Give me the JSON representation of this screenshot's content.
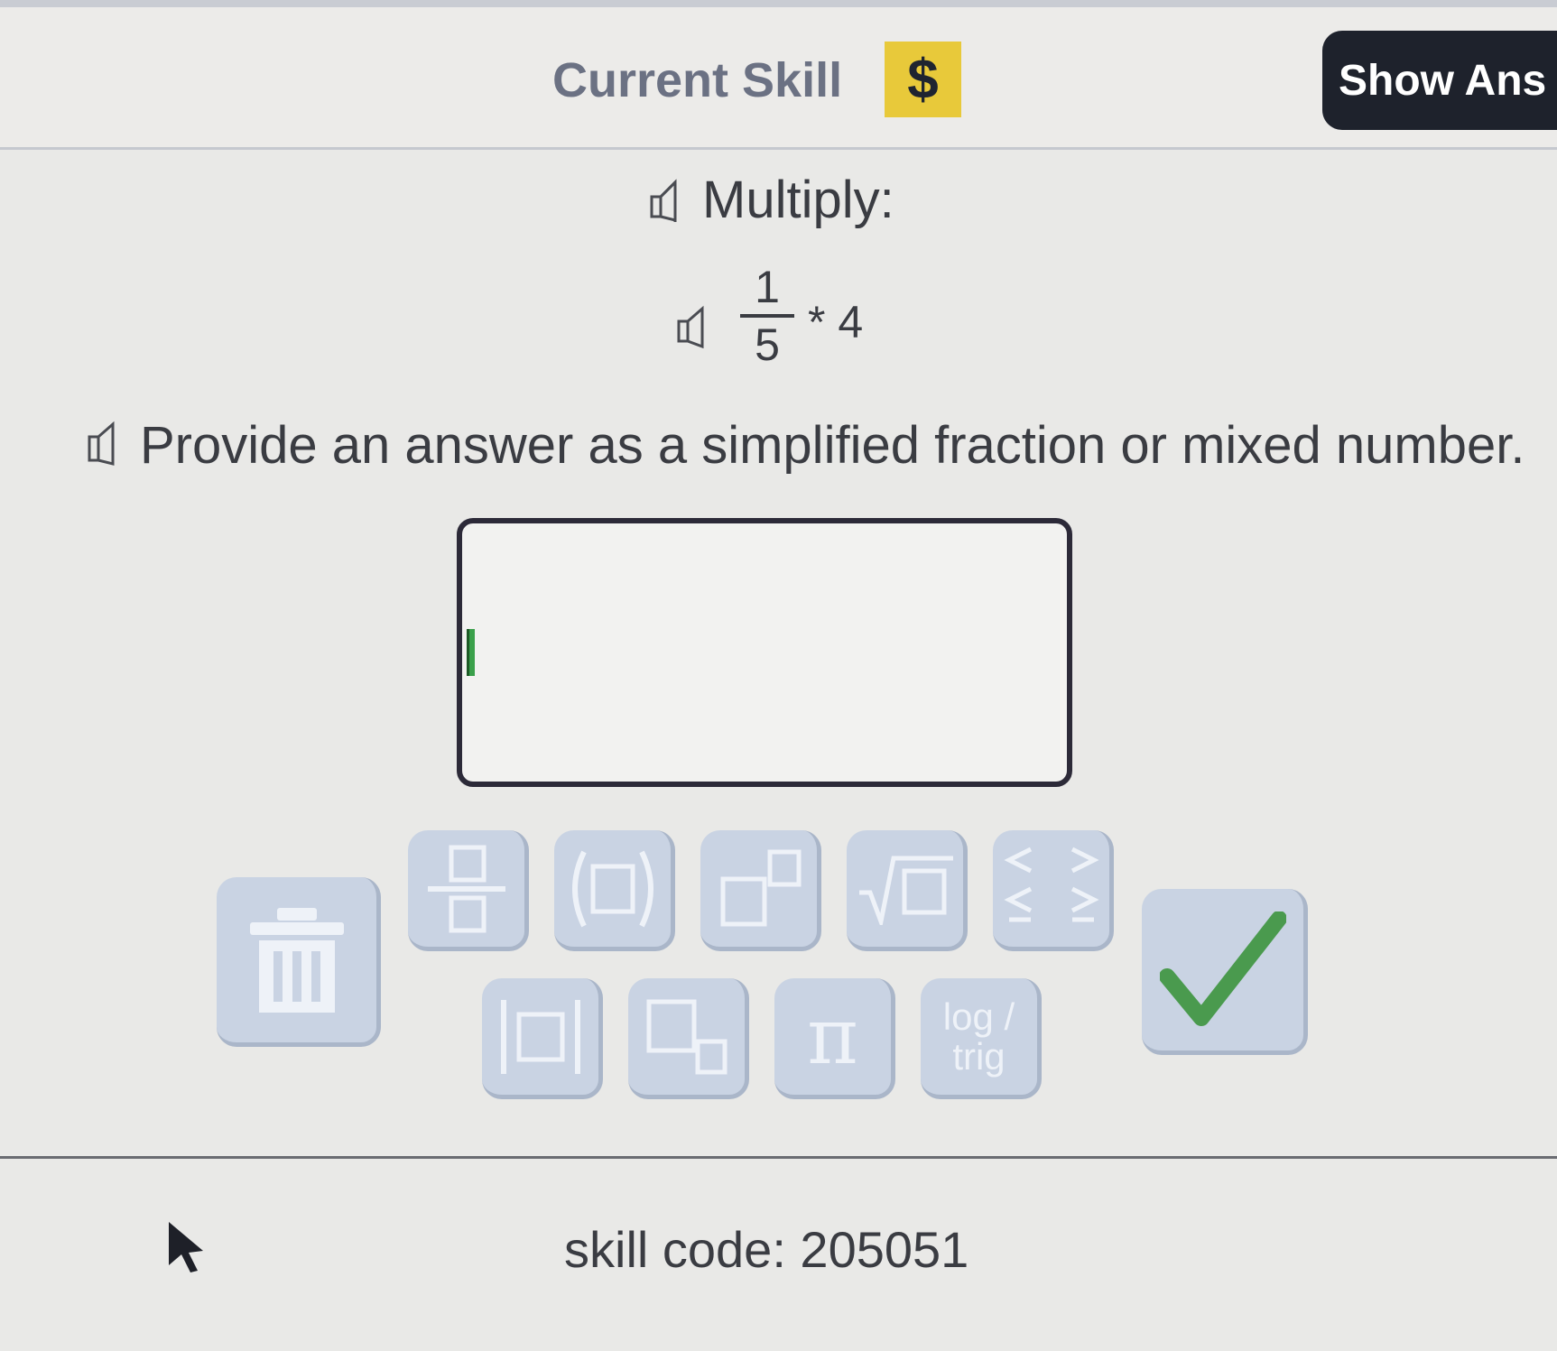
{
  "header": {
    "title": "Current Skill",
    "badge": "$",
    "show_answer_label": "Show Ans"
  },
  "question": {
    "instruction": "Multiply:",
    "expression": {
      "numerator": "1",
      "denominator": "5",
      "operator": "*",
      "operand": "4"
    },
    "answer_prompt": "Provide an answer as a simplified fraction or mixed number."
  },
  "answer": {
    "value": ""
  },
  "keypad": {
    "buttons": [
      {
        "name": "delete",
        "icon": "trash-icon"
      },
      {
        "name": "fraction",
        "icon": "fraction-icon"
      },
      {
        "name": "parentheses",
        "icon": "parentheses-icon"
      },
      {
        "name": "exponent",
        "icon": "exponent-icon"
      },
      {
        "name": "square-root",
        "icon": "square-root-icon"
      },
      {
        "name": "inequalities",
        "icon": "inequality-icon"
      },
      {
        "name": "absolute-value",
        "icon": "absolute-value-icon"
      },
      {
        "name": "subscript",
        "icon": "subscript-icon"
      },
      {
        "name": "pi",
        "icon": "pi-icon",
        "label": "π"
      },
      {
        "name": "log-trig",
        "label_top": "log /",
        "label_bottom": "trig"
      },
      {
        "name": "submit",
        "icon": "checkmark-icon"
      }
    ],
    "check_color": "#4a9a4e"
  },
  "footer": {
    "skill_code": "skill code: 205051"
  }
}
